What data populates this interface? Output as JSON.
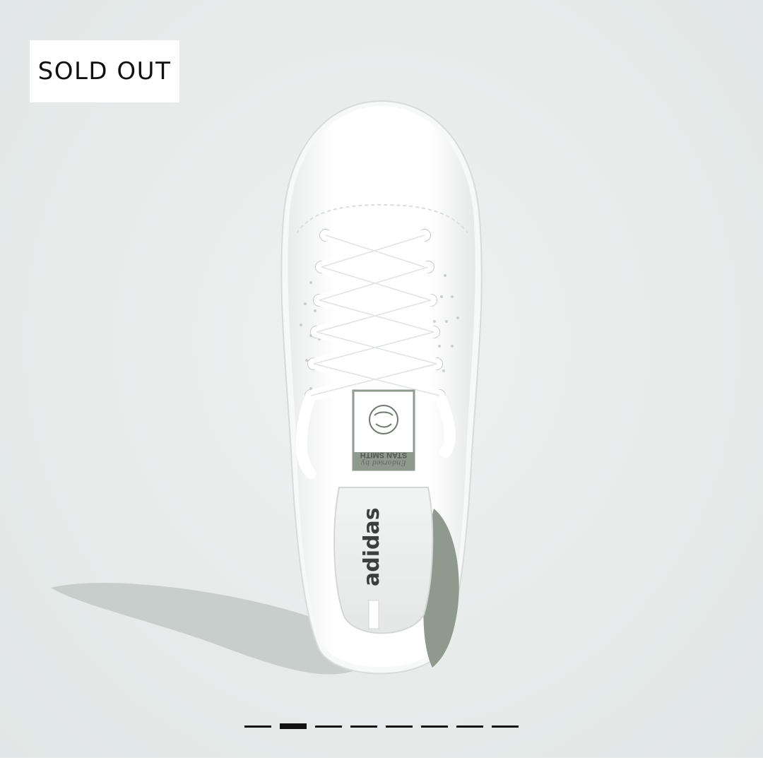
{
  "badge": {
    "label": "SOLD OUT"
  },
  "shoe": {
    "tongue_label_brand": "adidas",
    "tongue_label_name": "STAN SMITH",
    "tongue_label_endorsed": "Endorsed by",
    "insole_brand": "adidas"
  },
  "carousel": {
    "total": 8,
    "active_index": 1
  },
  "colors": {
    "background": "#e6ebea",
    "accent_green": "#8f9a8e",
    "shoe_white": "#ffffff"
  }
}
